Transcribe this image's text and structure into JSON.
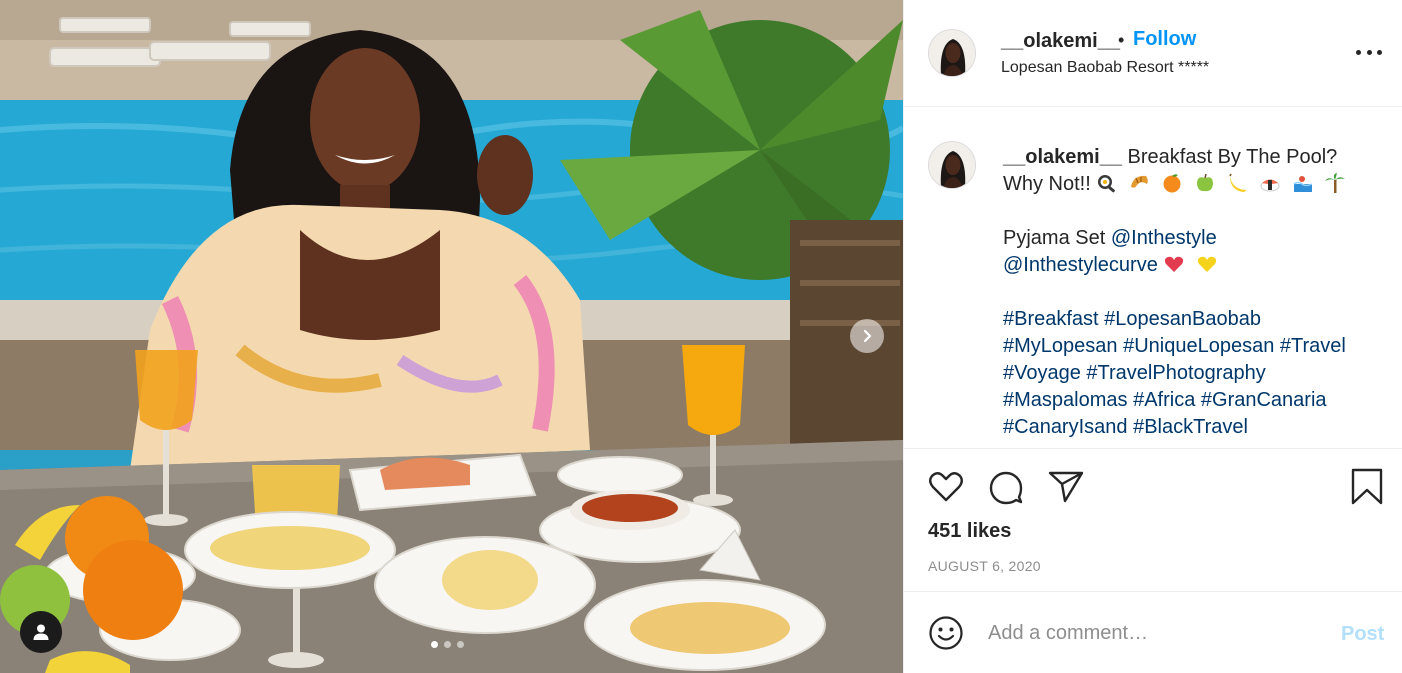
{
  "post": {
    "username": "__olakemi__",
    "separator": "•",
    "follow_label": "Follow",
    "location": "Lopesan Baobab Resort *****",
    "caption": {
      "username": "__olakemi__",
      "line1": "Breakfast By The Pool?",
      "line2": "Why Not!!",
      "emojis": [
        "frying-pan-egg",
        "croissant",
        "orange",
        "green-apple",
        "banana",
        "sushi",
        "pool",
        "palm-tree"
      ],
      "pyjama_prefix": "Pyjama Set",
      "mention1": "@Inthestyle",
      "mention2": "@Inthestylecurve",
      "mention2_emojis": [
        "red-heart",
        "yellow-heart"
      ],
      "hashtags": [
        "#Breakfast",
        "#LopesanBaobab",
        "#MyLopesan",
        "#UniqueLopesan",
        "#Travel",
        "#Voyage",
        "#TravelPhotography",
        "#Maspalomas",
        "#Africa",
        "#GranCanaria",
        "#CanaryIsand",
        "#BlackTravel"
      ]
    },
    "likes": "451 likes",
    "date": "AUGUST 6, 2020",
    "comment": {
      "placeholder": "Add a comment…",
      "post_label": "Post"
    }
  },
  "carousel": {
    "slide_count": 3,
    "active_slide": 1
  },
  "icons": {
    "like": "heart-icon",
    "comment": "comment-bubble-icon",
    "share": "paper-plane-icon",
    "save": "bookmark-icon",
    "more": "more-dots-icon",
    "emoji": "smiley-icon",
    "next": "chevron-right-icon",
    "user_tag": "user-tag-icon"
  },
  "colors": {
    "accent": "#0095f6",
    "link": "#00376b",
    "post_disabled": "#b2dffc",
    "muted": "#8e8e8e",
    "text": "#262626"
  }
}
